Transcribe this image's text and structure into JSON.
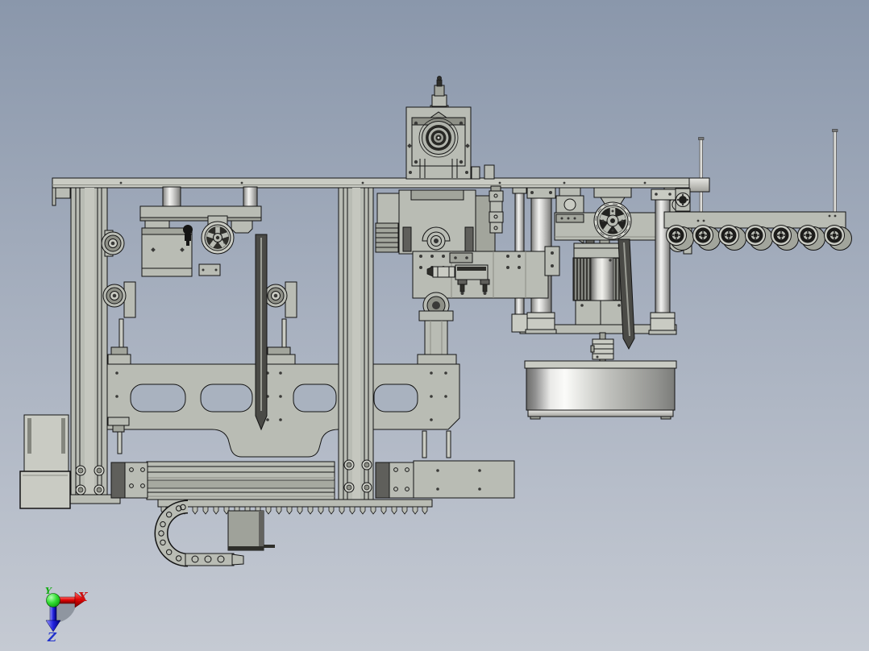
{
  "viewport": {
    "type": "cad-3d-viewport",
    "description": "Monochrome shaded front elevation of an automated machine assembly (gantry frame, spindle head, gear motor with drum, roller conveyor, linear rail with cable drag chain)",
    "background_top": "#8a97ab",
    "background_bottom": "#c5cad3"
  },
  "orientation_triad": {
    "origin_color": "#22cc22",
    "axes": [
      {
        "label": "X",
        "color": "#cc1111",
        "direction": "right"
      },
      {
        "label": "Y",
        "color": "#11aa11",
        "direction": "up"
      },
      {
        "label": "Z",
        "color": "#2233cc",
        "direction": "down"
      }
    ]
  },
  "palette": {
    "part_base": "#b9bcb4",
    "part_light": "#c9cbc3",
    "part_shadow": "#a2a59c",
    "part_dark": "#5f5f5b",
    "outline": "#141414",
    "metal_highlight": "#f2f2f0"
  },
  "components": [
    {
      "name": "top-mounting-plate"
    },
    {
      "name": "spindle-head"
    },
    {
      "name": "column-left"
    },
    {
      "name": "column-right"
    },
    {
      "name": "hanger-carriage"
    },
    {
      "name": "guide-pulleys"
    },
    {
      "name": "spoked-wheel-left"
    },
    {
      "name": "spoked-wheel-right"
    },
    {
      "name": "timing-belts"
    },
    {
      "name": "center-slide-block"
    },
    {
      "name": "vertical-drag-chain"
    },
    {
      "name": "support-posts"
    },
    {
      "name": "gear-motor"
    },
    {
      "name": "shaft-coupling"
    },
    {
      "name": "rotary-drum"
    },
    {
      "name": "roller-conveyor"
    },
    {
      "name": "sensor-rods"
    },
    {
      "name": "slotted-beam-plate"
    },
    {
      "name": "linear-rail"
    },
    {
      "name": "cable-drag-chain"
    },
    {
      "name": "junction-box"
    },
    {
      "name": "electronics-enclosures"
    }
  ]
}
